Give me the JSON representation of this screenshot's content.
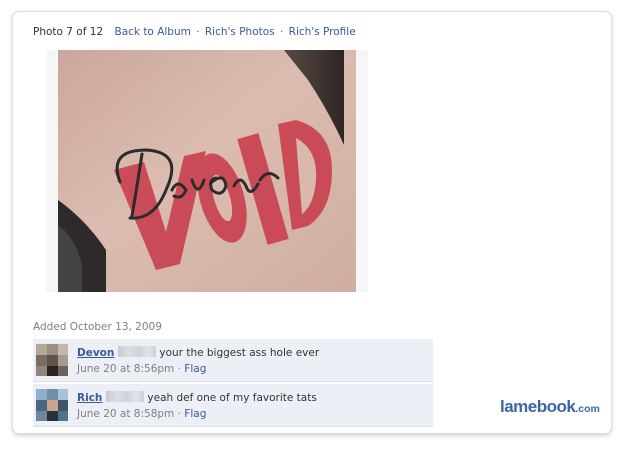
{
  "header": {
    "counter": "Photo 7 of 12",
    "links": [
      "Back to Album",
      "Rich's Photos",
      "Rich's Profile"
    ],
    "separator": "·"
  },
  "photo": {
    "tattoo_script": "Devon",
    "tattoo_block": "VOID",
    "colors": {
      "skin": "#d9b9ad",
      "block_letters": "#c9404f",
      "script": "#2b2b2b"
    }
  },
  "added_date": "Added October 13, 2009",
  "comments": [
    {
      "author": "Devon",
      "text": "your the biggest ass hole ever",
      "time": "June 20 at 8:56pm",
      "flag": "Flag"
    },
    {
      "author": "Rich",
      "text": "yeah def one of my favorite tats",
      "time": "June 20 at 8:58pm",
      "flag": "Flag"
    }
  ],
  "watermark": {
    "brand": "lamebook",
    "tld": ".com"
  },
  "colors": {
    "link": "#3b5998",
    "comment_bg": "#eceff5",
    "muted": "#808080"
  }
}
